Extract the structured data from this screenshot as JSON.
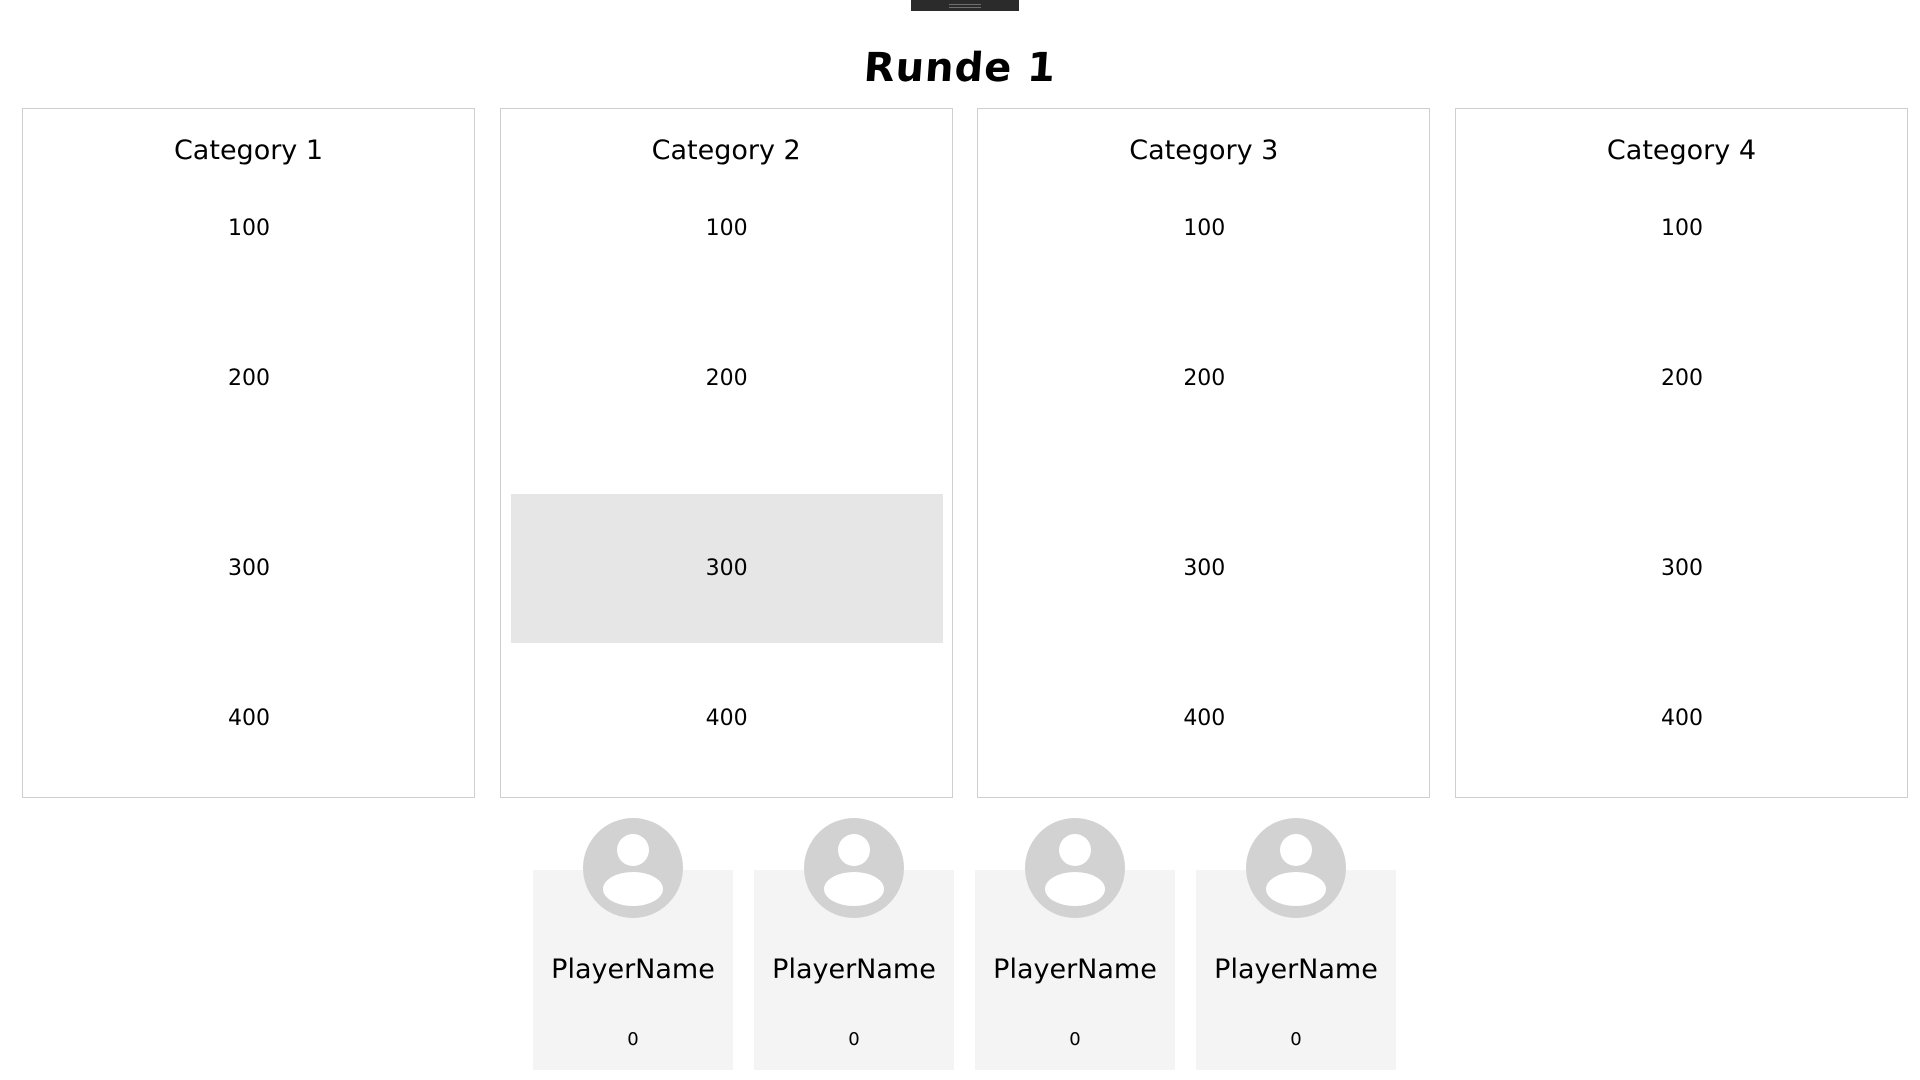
{
  "title": "Runde 1",
  "categories": [
    {
      "name": "Category 1",
      "values": [
        "100",
        "200",
        "300",
        "400"
      ]
    },
    {
      "name": "Category 2",
      "values": [
        "100",
        "200",
        "300",
        "400"
      ]
    },
    {
      "name": "Category 3",
      "values": [
        "100",
        "200",
        "300",
        "400"
      ]
    },
    {
      "name": "Category 4",
      "values": [
        "100",
        "200",
        "300",
        "400"
      ]
    }
  ],
  "selected_cell": {
    "category": "Category 2",
    "value": "300"
  },
  "players": [
    {
      "name": "PlayerName",
      "score": "0"
    },
    {
      "name": "PlayerName",
      "score": "0"
    },
    {
      "name": "PlayerName",
      "score": "0"
    },
    {
      "name": "PlayerName",
      "score": "0"
    }
  ],
  "icons": {
    "avatar": "user-avatar-icon",
    "handle": "drag-handle-icon"
  },
  "colors": {
    "selected_cell": "#e6e6e6",
    "player_card": "#f4f4f4",
    "avatar": "#d2d2d2",
    "border": "#cfcfcf"
  }
}
